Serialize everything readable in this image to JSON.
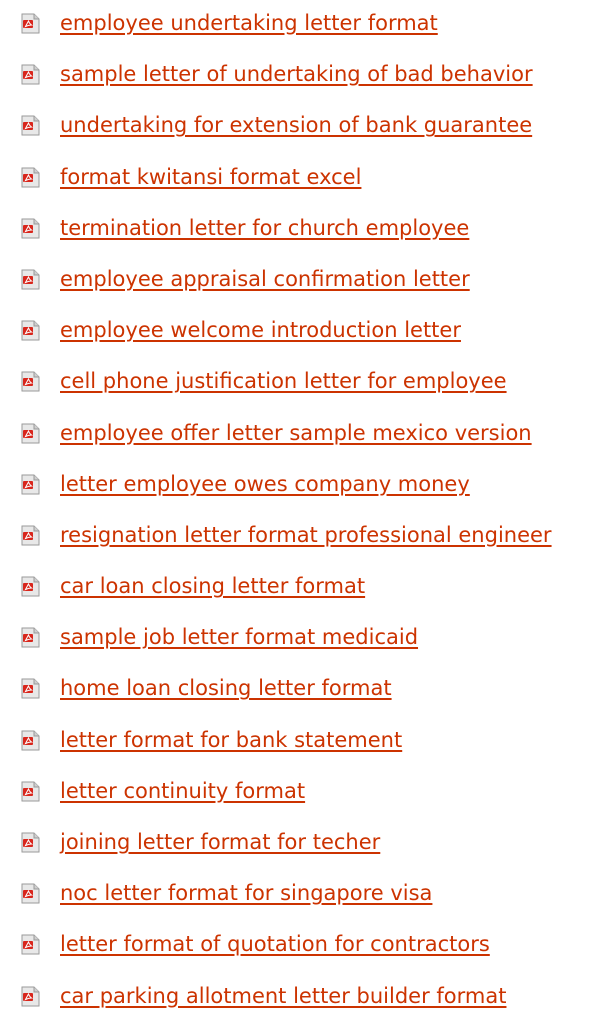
{
  "colors": {
    "link": "#cc3300",
    "icon_red": "#d8261c",
    "icon_page": "#e8e8e8"
  },
  "icon": "pdf-document-icon",
  "links": [
    {
      "label": "employee undertaking letter format"
    },
    {
      "label": "sample letter of undertaking of bad behavior"
    },
    {
      "label": "undertaking for extension of bank guarantee"
    },
    {
      "label": "format kwitansi format excel"
    },
    {
      "label": "termination letter for church employee"
    },
    {
      "label": "employee appraisal confirmation letter"
    },
    {
      "label": "employee welcome introduction letter"
    },
    {
      "label": "cell phone justification letter for employee"
    },
    {
      "label": "employee offer letter sample mexico version"
    },
    {
      "label": "letter employee owes company money"
    },
    {
      "label": "resignation letter format professional engineer"
    },
    {
      "label": "car loan closing letter format"
    },
    {
      "label": "sample job letter format medicaid"
    },
    {
      "label": "home loan closing letter format"
    },
    {
      "label": "letter format for bank statement"
    },
    {
      "label": "letter continuity format"
    },
    {
      "label": "joining letter format for techer"
    },
    {
      "label": "noc letter format for singapore visa"
    },
    {
      "label": "letter format of quotation for contractors"
    },
    {
      "label": "car parking allotment letter builder format"
    }
  ]
}
